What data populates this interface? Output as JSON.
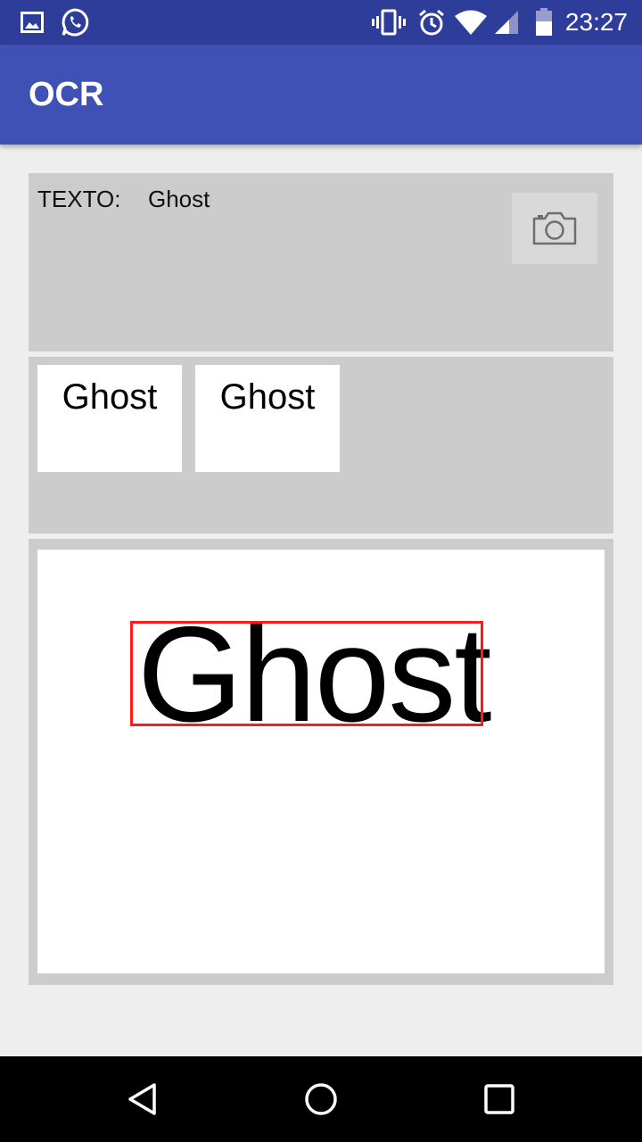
{
  "status_bar": {
    "time": "23:27",
    "icons": [
      "image-icon",
      "whatsapp-icon",
      "vibrate-icon",
      "alarm-icon",
      "wifi-icon",
      "signal-icon",
      "battery-icon"
    ]
  },
  "app_bar": {
    "title": "OCR"
  },
  "text_panel": {
    "label": "TEXTO:",
    "value": "Ghost",
    "camera_icon": "camera-icon"
  },
  "thumbnails": [
    {
      "text": "Ghost"
    },
    {
      "text": "Ghost"
    }
  ],
  "image_view": {
    "word": "Ghost",
    "box_color": "#FF1A1A"
  },
  "nav_bar": {
    "icons": [
      "back-icon",
      "home-icon",
      "recents-icon"
    ]
  },
  "colors": {
    "status_bar": "#2F3D9A",
    "app_bar": "#3F51B5",
    "background": "#EEEEEE",
    "panel": "#CCCCCC"
  }
}
